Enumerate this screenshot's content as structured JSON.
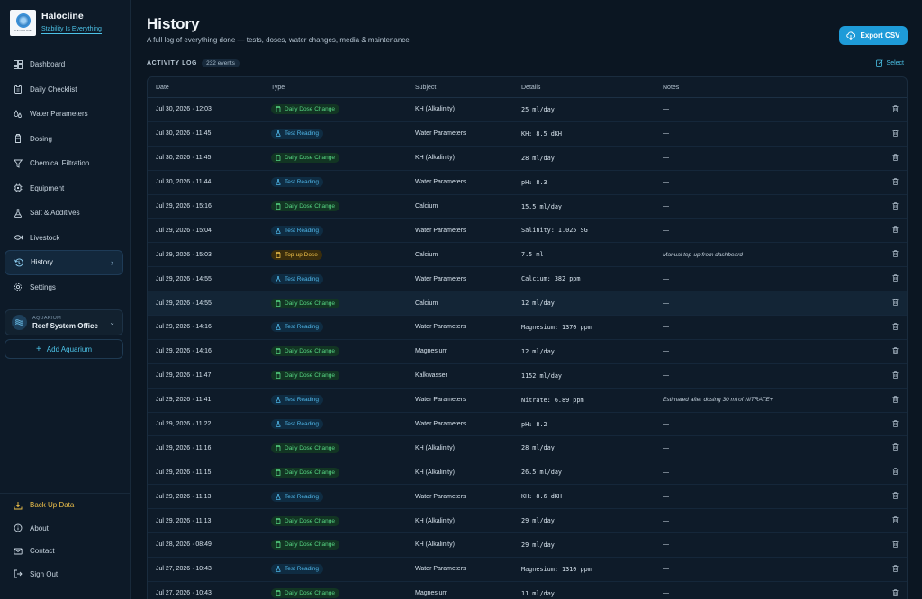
{
  "app": {
    "name": "Halocline",
    "tagline": "Stability Is Everything",
    "logo_text": "HALOCLINE"
  },
  "sidebar": {
    "items": [
      {
        "label": "Dashboard",
        "icon": "dashboard-icon"
      },
      {
        "label": "Daily Checklist",
        "icon": "checklist-icon"
      },
      {
        "label": "Water Parameters",
        "icon": "droplets-icon"
      },
      {
        "label": "Dosing",
        "icon": "bottle-icon"
      },
      {
        "label": "Chemical Filtration",
        "icon": "filter-icon"
      },
      {
        "label": "Equipment",
        "icon": "cpu-icon"
      },
      {
        "label": "Salt & Additives",
        "icon": "flask-icon"
      },
      {
        "label": "Livestock",
        "icon": "fish-icon"
      },
      {
        "label": "History",
        "icon": "history-icon",
        "active": true
      },
      {
        "label": "Settings",
        "icon": "gear-icon"
      }
    ],
    "aquarium": {
      "label": "AQUARIUM",
      "name": "Reef System Office"
    },
    "add_aquarium": "Add Aquarium",
    "bottom": [
      {
        "label": "Back Up Data",
        "icon": "backup-icon"
      },
      {
        "label": "About",
        "icon": "info-icon"
      },
      {
        "label": "Contact",
        "icon": "mail-icon"
      },
      {
        "label": "Sign Out",
        "icon": "sign-out-icon"
      }
    ]
  },
  "header": {
    "title": "History",
    "subtitle": "A full log of everything done — tests, doses, water changes, media & maintenance",
    "export_label": "Export CSV"
  },
  "log": {
    "label": "ACTIVITY LOG",
    "count": "232 events",
    "select_label": "Select",
    "columns": [
      "Date",
      "Type",
      "Subject",
      "Details",
      "Notes"
    ],
    "rows": [
      {
        "date": "Jul 30, 2026 · 12:03",
        "type": "Daily Dose Change",
        "kind": "dose",
        "subject": "KH (Alkalinity)",
        "details": "25 ml/day",
        "notes": "—"
      },
      {
        "date": "Jul 30, 2026 · 11:45",
        "type": "Test Reading",
        "kind": "test",
        "subject": "Water Parameters",
        "details": "KH: 8.5 dKH",
        "notes": "—"
      },
      {
        "date": "Jul 30, 2026 · 11:45",
        "type": "Daily Dose Change",
        "kind": "dose",
        "subject": "KH (Alkalinity)",
        "details": "28 ml/day",
        "notes": "—"
      },
      {
        "date": "Jul 30, 2026 · 11:44",
        "type": "Test Reading",
        "kind": "test",
        "subject": "Water Parameters",
        "details": "pH: 8.3",
        "notes": "—"
      },
      {
        "date": "Jul 29, 2026 · 15:16",
        "type": "Daily Dose Change",
        "kind": "dose",
        "subject": "Calcium",
        "details": "15.5 ml/day",
        "notes": "—"
      },
      {
        "date": "Jul 29, 2026 · 15:04",
        "type": "Test Reading",
        "kind": "test",
        "subject": "Water Parameters",
        "details": "Salinity: 1.025 SG",
        "notes": "—"
      },
      {
        "date": "Jul 29, 2026 · 15:03",
        "type": "Top-up Dose",
        "kind": "top",
        "subject": "Calcium",
        "details": "7.5 ml",
        "notes": "Manual top-up from dashboard"
      },
      {
        "date": "Jul 29, 2026 · 14:55",
        "type": "Test Reading",
        "kind": "test",
        "subject": "Water Parameters",
        "details": "Calcium: 382 ppm",
        "notes": "—"
      },
      {
        "date": "Jul 29, 2026 · 14:55",
        "type": "Daily Dose Change",
        "kind": "dose",
        "subject": "Calcium",
        "details": "12 ml/day",
        "notes": "—",
        "highlight": true
      },
      {
        "date": "Jul 29, 2026 · 14:16",
        "type": "Test Reading",
        "kind": "test",
        "subject": "Water Parameters",
        "details": "Magnesium: 1370 ppm",
        "notes": "—"
      },
      {
        "date": "Jul 29, 2026 · 14:16",
        "type": "Daily Dose Change",
        "kind": "dose",
        "subject": "Magnesium",
        "details": "12 ml/day",
        "notes": "—"
      },
      {
        "date": "Jul 29, 2026 · 11:47",
        "type": "Daily Dose Change",
        "kind": "dose",
        "subject": "Kalkwasser",
        "details": "1152 ml/day",
        "notes": "—"
      },
      {
        "date": "Jul 29, 2026 · 11:41",
        "type": "Test Reading",
        "kind": "test",
        "subject": "Water Parameters",
        "details": "Nitrate: 6.89 ppm",
        "notes": "Estimated after dosing 30 ml of NITRATE+"
      },
      {
        "date": "Jul 29, 2026 · 11:22",
        "type": "Test Reading",
        "kind": "test",
        "subject": "Water Parameters",
        "details": "pH: 8.2",
        "notes": "—"
      },
      {
        "date": "Jul 29, 2026 · 11:16",
        "type": "Daily Dose Change",
        "kind": "dose",
        "subject": "KH (Alkalinity)",
        "details": "28 ml/day",
        "notes": "—"
      },
      {
        "date": "Jul 29, 2026 · 11:15",
        "type": "Daily Dose Change",
        "kind": "dose",
        "subject": "KH (Alkalinity)",
        "details": "26.5 ml/day",
        "notes": "—"
      },
      {
        "date": "Jul 29, 2026 · 11:13",
        "type": "Test Reading",
        "kind": "test",
        "subject": "Water Parameters",
        "details": "KH: 8.6 dKH",
        "notes": "—"
      },
      {
        "date": "Jul 29, 2026 · 11:13",
        "type": "Daily Dose Change",
        "kind": "dose",
        "subject": "KH (Alkalinity)",
        "details": "29 ml/day",
        "notes": "—"
      },
      {
        "date": "Jul 28, 2026 · 08:49",
        "type": "Daily Dose Change",
        "kind": "dose",
        "subject": "KH (Alkalinity)",
        "details": "29 ml/day",
        "notes": "—"
      },
      {
        "date": "Jul 27, 2026 · 10:43",
        "type": "Test Reading",
        "kind": "test",
        "subject": "Water Parameters",
        "details": "Magnesium: 1310 ppm",
        "notes": "—"
      },
      {
        "date": "Jul 27, 2026 · 10:43",
        "type": "Daily Dose Change",
        "kind": "dose",
        "subject": "Magnesium",
        "details": "11 ml/day",
        "notes": "—"
      }
    ]
  }
}
